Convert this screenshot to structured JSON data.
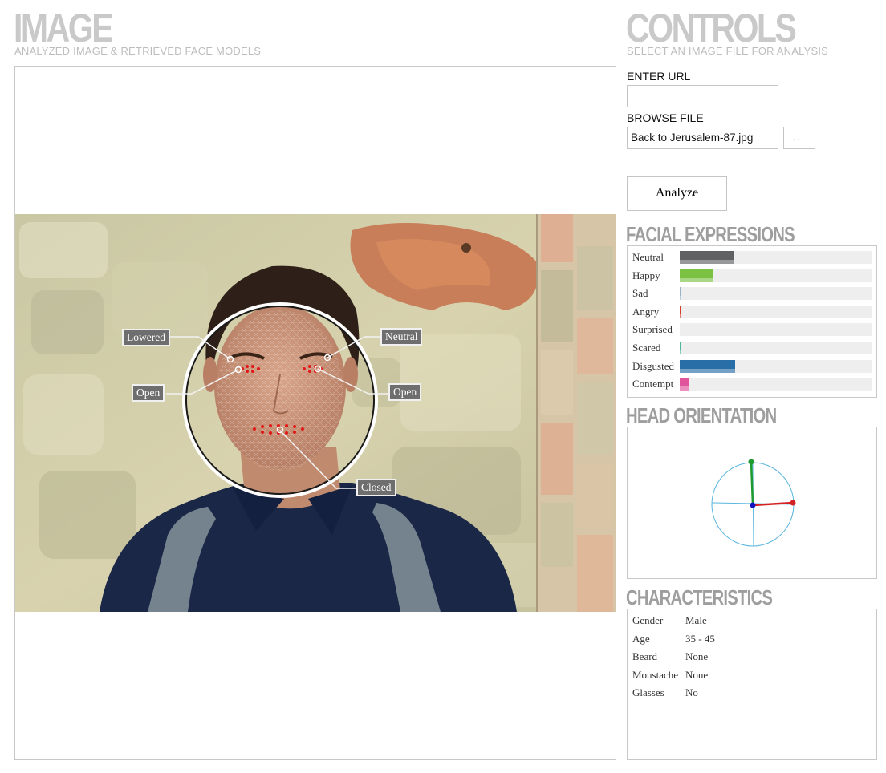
{
  "image_section": {
    "title": "IMAGE",
    "subtitle": "ANALYZED IMAGE & RETRIEVED FACE MODELS"
  },
  "controls_section": {
    "title": "CONTROLS",
    "subtitle": "SELECT AN IMAGE FILE FOR ANALYSIS",
    "url_label": "ENTER URL",
    "url_value": "",
    "browse_label": "BROWSE FILE",
    "file_name": "Back to Jerusalem-87.jpg",
    "browse_button": "...",
    "analyze_button": "Analyze"
  },
  "photo_annotations": {
    "left_brow": "Lowered",
    "right_brow": "Neutral",
    "left_eye": "Open",
    "right_eye": "Open",
    "mouth": "Closed"
  },
  "facial_expressions": {
    "title": "FACIAL EXPRESSIONS",
    "items": [
      {
        "label": "Neutral",
        "value": 0.28,
        "color": "#5f6163"
      },
      {
        "label": "Happy",
        "value": 0.17,
        "color": "#7cc242"
      },
      {
        "label": "Sad",
        "value": 0.004,
        "color": "#9ab3c4"
      },
      {
        "label": "Angry",
        "value": 0.008,
        "color": "#d33b2c"
      },
      {
        "label": "Surprised",
        "value": 0.0,
        "color": "#cccccc"
      },
      {
        "label": "Scared",
        "value": 0.004,
        "color": "#4bb6a0"
      },
      {
        "label": "Disgusted",
        "value": 0.29,
        "color": "#2a6ea8"
      },
      {
        "label": "Contempt",
        "value": 0.045,
        "color": "#e0559c"
      }
    ]
  },
  "head_orientation": {
    "title": "HEAD ORIENTATION",
    "axis_colors": {
      "up": "#1f9a2e",
      "side": "#d42222",
      "center": "#1515c0",
      "circle": "#58b6dc"
    }
  },
  "characteristics": {
    "title": "CHARACTERISTICS",
    "items": [
      {
        "key": "Gender",
        "value": "Male"
      },
      {
        "key": "Age",
        "value": "35 - 45"
      },
      {
        "key": "Beard",
        "value": "None"
      },
      {
        "key": "Moustache",
        "value": "None"
      },
      {
        "key": "Glasses",
        "value": "No"
      }
    ]
  }
}
